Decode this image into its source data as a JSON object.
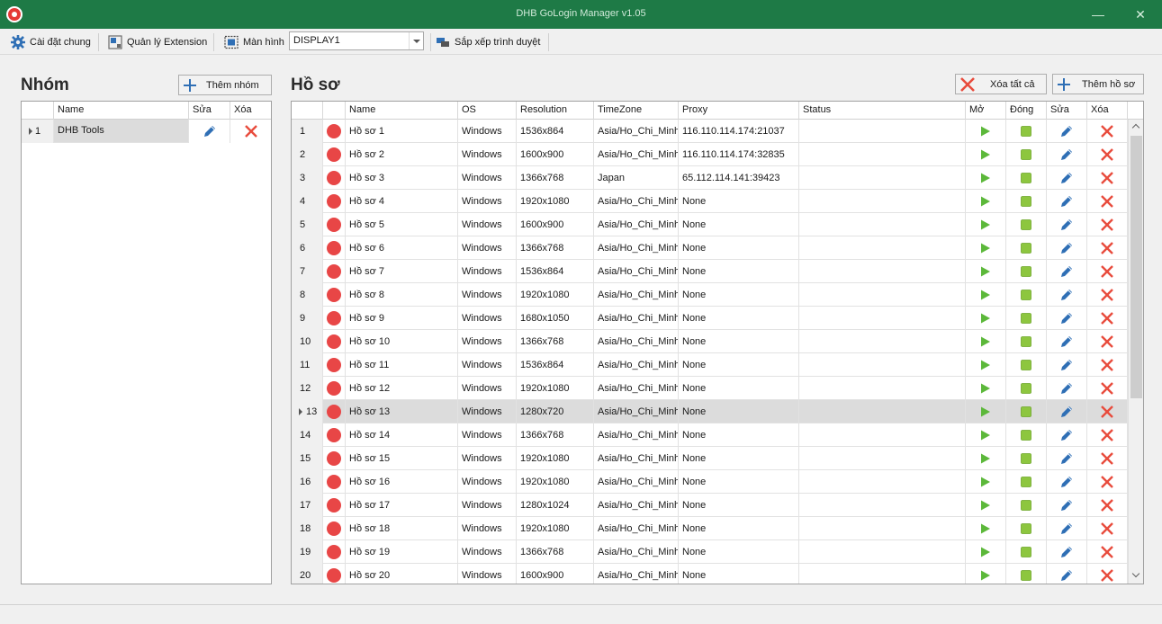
{
  "window": {
    "title": "DHB GoLogin Manager v1.05",
    "minimize": "—",
    "close": "✕"
  },
  "toolbar": {
    "settings_label": "Cài đặt chung",
    "extension_label": "Quản lý Extension",
    "display_label": "Màn hình",
    "display_value": "DISPLAY1",
    "arrange_label": "Sắp xếp trình duyệt"
  },
  "groups": {
    "title": "Nhóm",
    "add_button": "Thêm nhóm",
    "columns": [
      "Name",
      "Sửa",
      "Xóa"
    ],
    "rows": [
      {
        "index": "1",
        "name": "DHB Tools"
      }
    ]
  },
  "profiles": {
    "title": "Hồ sơ",
    "delete_all_button": "Xóa tất cả",
    "add_button": "Thêm hồ sơ",
    "columns": [
      "Name",
      "OS",
      "Resolution",
      "TimeZone",
      "Proxy",
      "Status",
      "Mở",
      "Đóng",
      "Sửa",
      "Xóa"
    ],
    "selected_row": 13,
    "rows": [
      {
        "index": "1",
        "name": "Hồ sơ 1",
        "os": "Windows",
        "resolution": "1536x864",
        "timezone": "Asia/Ho_Chi_Minh",
        "proxy": "116.110.114.174:21037",
        "status": ""
      },
      {
        "index": "2",
        "name": "Hồ sơ 2",
        "os": "Windows",
        "resolution": "1600x900",
        "timezone": "Asia/Ho_Chi_Minh",
        "proxy": "116.110.114.174:32835",
        "status": ""
      },
      {
        "index": "3",
        "name": "Hồ sơ 3",
        "os": "Windows",
        "resolution": "1366x768",
        "timezone": "Japan",
        "proxy": "65.112.114.141:39423",
        "status": ""
      },
      {
        "index": "4",
        "name": "Hồ sơ 4",
        "os": "Windows",
        "resolution": "1920x1080",
        "timezone": "Asia/Ho_Chi_Minh",
        "proxy": "None",
        "status": ""
      },
      {
        "index": "5",
        "name": "Hồ sơ 5",
        "os": "Windows",
        "resolution": "1600x900",
        "timezone": "Asia/Ho_Chi_Minh",
        "proxy": "None",
        "status": ""
      },
      {
        "index": "6",
        "name": "Hồ sơ 6",
        "os": "Windows",
        "resolution": "1366x768",
        "timezone": "Asia/Ho_Chi_Minh",
        "proxy": "None",
        "status": ""
      },
      {
        "index": "7",
        "name": "Hồ sơ 7",
        "os": "Windows",
        "resolution": "1536x864",
        "timezone": "Asia/Ho_Chi_Minh",
        "proxy": "None",
        "status": ""
      },
      {
        "index": "8",
        "name": "Hồ sơ 8",
        "os": "Windows",
        "resolution": "1920x1080",
        "timezone": "Asia/Ho_Chi_Minh",
        "proxy": "None",
        "status": ""
      },
      {
        "index": "9",
        "name": "Hồ sơ 9",
        "os": "Windows",
        "resolution": "1680x1050",
        "timezone": "Asia/Ho_Chi_Minh",
        "proxy": "None",
        "status": ""
      },
      {
        "index": "10",
        "name": "Hồ sơ 10",
        "os": "Windows",
        "resolution": "1366x768",
        "timezone": "Asia/Ho_Chi_Minh",
        "proxy": "None",
        "status": ""
      },
      {
        "index": "11",
        "name": "Hồ sơ 11",
        "os": "Windows",
        "resolution": "1536x864",
        "timezone": "Asia/Ho_Chi_Minh",
        "proxy": "None",
        "status": ""
      },
      {
        "index": "12",
        "name": "Hồ sơ 12",
        "os": "Windows",
        "resolution": "1920x1080",
        "timezone": "Asia/Ho_Chi_Minh",
        "proxy": "None",
        "status": ""
      },
      {
        "index": "13",
        "name": "Hồ sơ 13",
        "os": "Windows",
        "resolution": "1280x720",
        "timezone": "Asia/Ho_Chi_Minh",
        "proxy": "None",
        "status": ""
      },
      {
        "index": "14",
        "name": "Hồ sơ 14",
        "os": "Windows",
        "resolution": "1366x768",
        "timezone": "Asia/Ho_Chi_Minh",
        "proxy": "None",
        "status": ""
      },
      {
        "index": "15",
        "name": "Hồ sơ 15",
        "os": "Windows",
        "resolution": "1920x1080",
        "timezone": "Asia/Ho_Chi_Minh",
        "proxy": "None",
        "status": ""
      },
      {
        "index": "16",
        "name": "Hồ sơ 16",
        "os": "Windows",
        "resolution": "1920x1080",
        "timezone": "Asia/Ho_Chi_Minh",
        "proxy": "None",
        "status": ""
      },
      {
        "index": "17",
        "name": "Hồ sơ 17",
        "os": "Windows",
        "resolution": "1280x1024",
        "timezone": "Asia/Ho_Chi_Minh",
        "proxy": "None",
        "status": ""
      },
      {
        "index": "18",
        "name": "Hồ sơ 18",
        "os": "Windows",
        "resolution": "1920x1080",
        "timezone": "Asia/Ho_Chi_Minh",
        "proxy": "None",
        "status": ""
      },
      {
        "index": "19",
        "name": "Hồ sơ 19",
        "os": "Windows",
        "resolution": "1366x768",
        "timezone": "Asia/Ho_Chi_Minh",
        "proxy": "None",
        "status": ""
      },
      {
        "index": "20",
        "name": "Hồ sơ 20",
        "os": "Windows",
        "resolution": "1600x900",
        "timezone": "Asia/Ho_Chi_Minh",
        "proxy": "None",
        "status": ""
      }
    ]
  },
  "icons": {
    "app": "app-icon",
    "settings": "gear-icon",
    "extension": "extension-icon",
    "display": "monitor-icon",
    "arrange": "arrange-windows-icon",
    "add": "plus-icon",
    "delete": "close-x-icon",
    "edit": "pencil-icon",
    "open": "play-icon",
    "close_profile": "stop-icon",
    "status": "status-dot-icon"
  },
  "colors": {
    "titlebar": "#1e7a46",
    "status_dot": "#e84646",
    "play": "#5cb83a",
    "stop": "#8dc63f",
    "edit": "#2f6fb5",
    "delete": "#e84b3c",
    "accent_blue": "#2f6fb5"
  }
}
